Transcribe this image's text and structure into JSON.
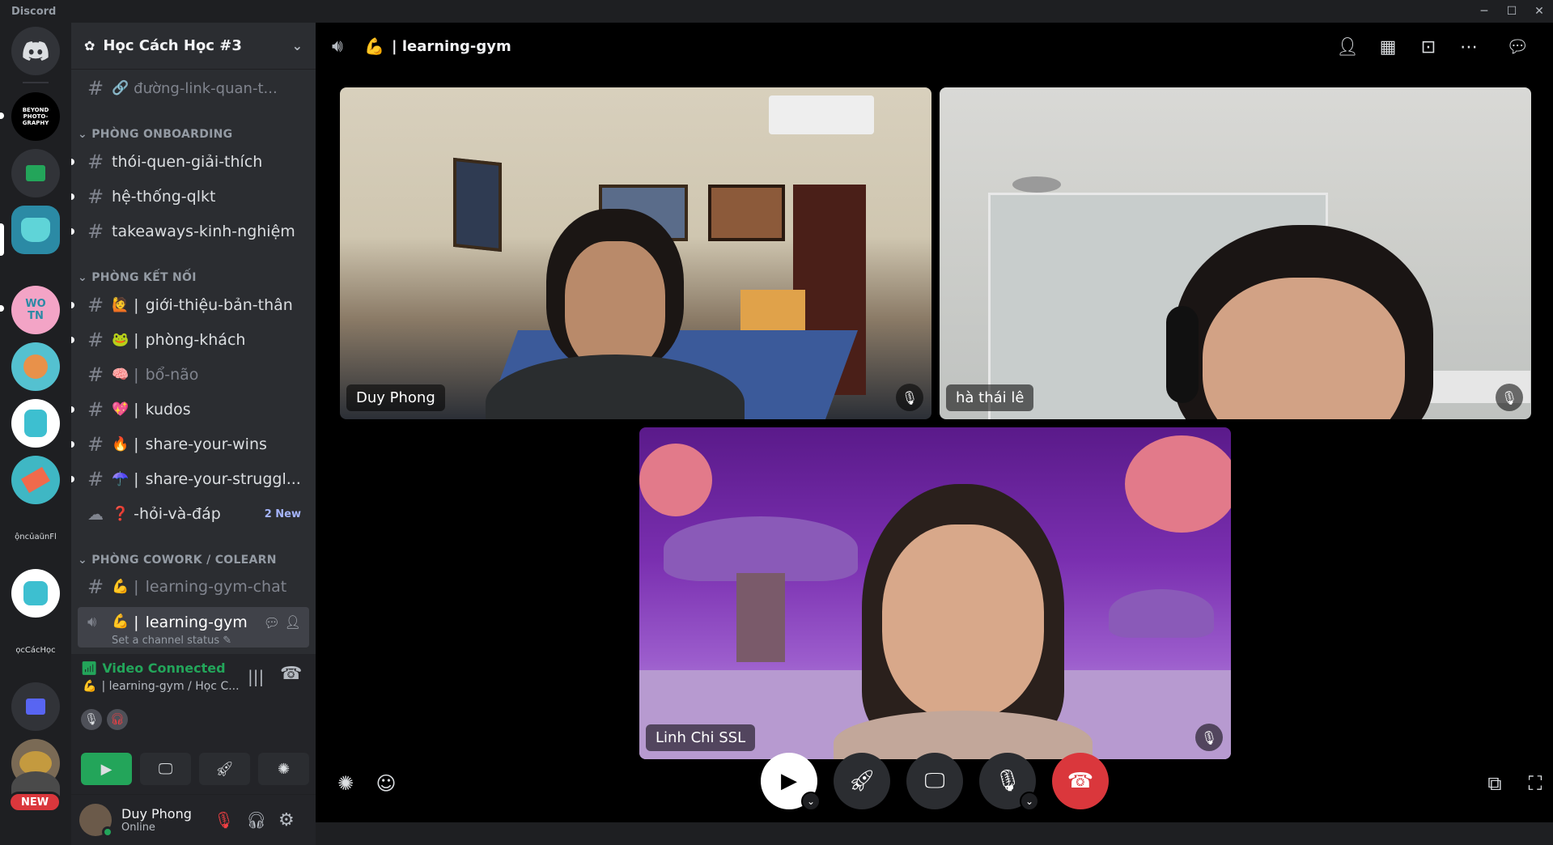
{
  "app": {
    "title": "Discord"
  },
  "guilds": [
    {
      "label": "BEYOND PHOTO-GRAPHY"
    },
    {
      "label": "ộncủaũnFl"
    },
    {
      "label": "ọcCácHọc"
    }
  ],
  "new_badge": "NEW",
  "server": {
    "name": "Học Cách Học #3"
  },
  "channels_top": [
    {
      "name": "đường-link-quan-t...",
      "emoji": "🔗"
    }
  ],
  "categories": {
    "onboarding": "PHÒNG ONBOARDING",
    "ketnoi": "PHÒNG KẾT NỐI",
    "cowork": "PHÒNG COWORK / COLEARN"
  },
  "onboarding": [
    {
      "name": "thói-quen-giải-thích"
    },
    {
      "name": "hệ-thống-qlkt"
    },
    {
      "name": "takeaways-kinh-nghiệm"
    }
  ],
  "ketnoi": [
    {
      "name": "giới-thiệu-bản-thân",
      "emoji": "🙋"
    },
    {
      "name": "phòng-khách",
      "emoji": "🐸"
    },
    {
      "name": "bổ-não",
      "emoji": "🧠"
    },
    {
      "name": "kudos",
      "emoji": "💖"
    },
    {
      "name": "share-your-wins",
      "emoji": "🔥"
    },
    {
      "name": "share-your-struggl...",
      "emoji": "☂️"
    },
    {
      "name": "-hỏi-và-đáp",
      "emoji": "❓",
      "badge": "2 New"
    }
  ],
  "cowork": [
    {
      "name": "learning-gym-chat",
      "emoji": "💪"
    },
    {
      "name": "learning-gym",
      "emoji": "💪",
      "status": "Set a channel status"
    }
  ],
  "voice": {
    "status": "Video Connected",
    "location": "| learning-gym / Học C...",
    "location_emoji": "💪"
  },
  "user": {
    "name": "Duy Phong",
    "status": "Online"
  },
  "header": {
    "channel": "| learning-gym",
    "emoji": "💪"
  },
  "tiles": [
    {
      "name": "Duy Phong"
    },
    {
      "name": "hà thái lê"
    },
    {
      "name": "Linh Chi SSL"
    }
  ],
  "colors": {
    "accent": "#5865f2",
    "connected": "#23a55a",
    "hangup": "#da373c",
    "mute_red": "#f23f43"
  }
}
